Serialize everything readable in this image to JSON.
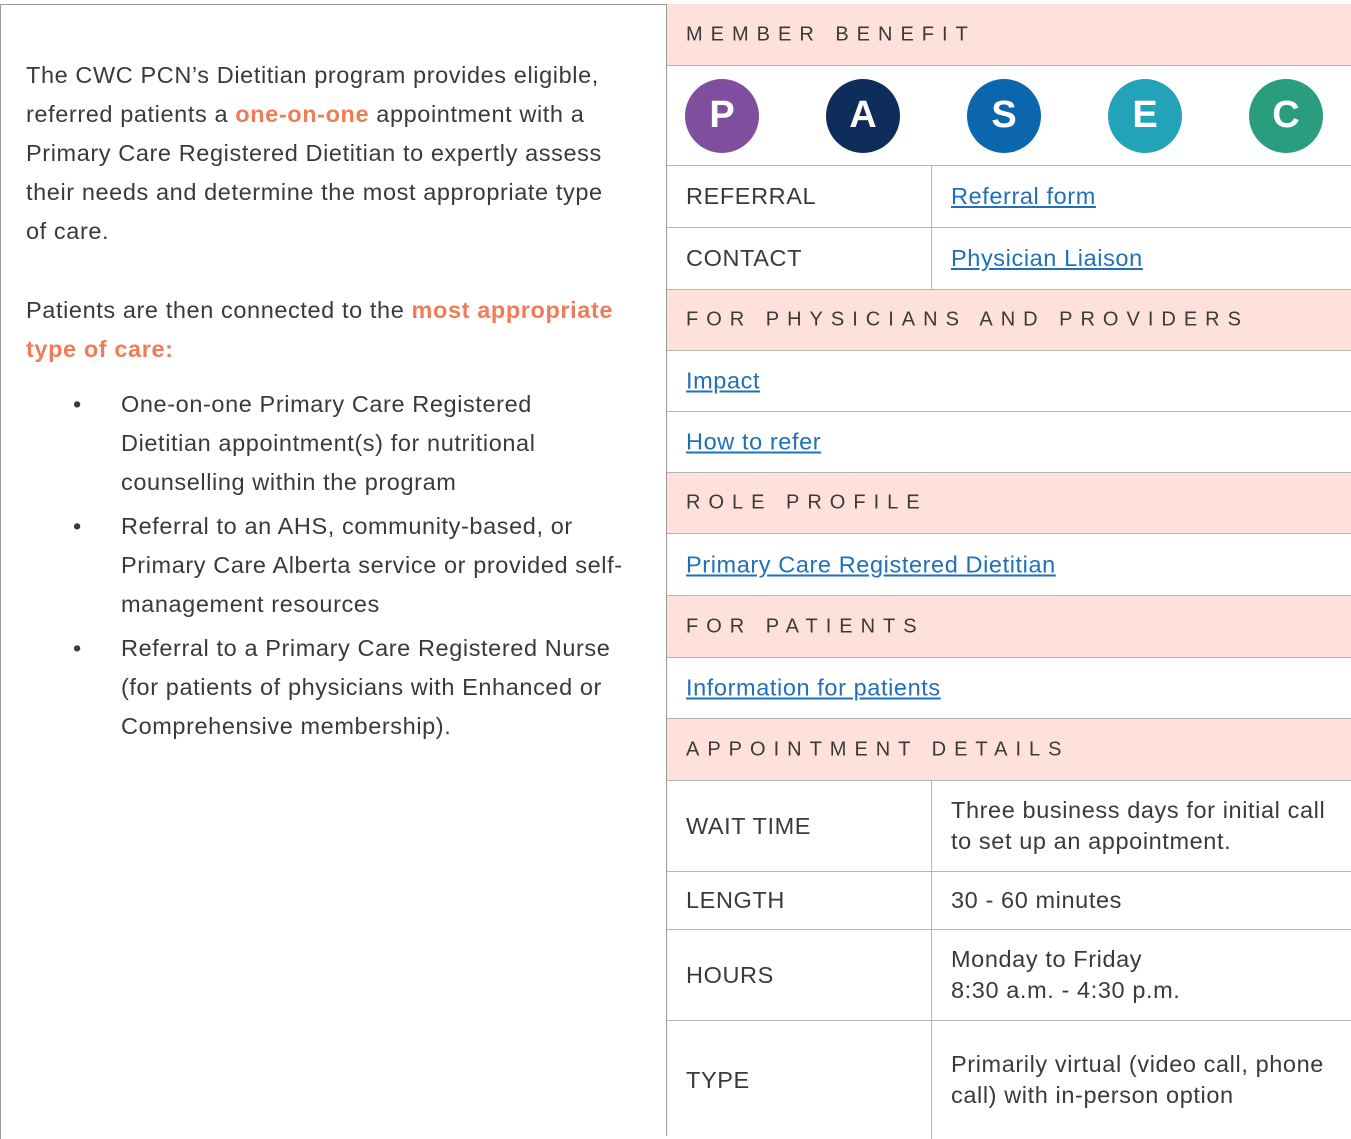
{
  "intro": {
    "p1_a": "The CWC PCN’s Dietitian program provides eligible, referred patients a ",
    "p1_hl": "one-on-one",
    "p1_b": " appointment with a Primary Care Registered Dietitian to expertly assess their needs and determine the most appropriate type of care.",
    "p2_a": "Patients are then connected to the ",
    "p2_hl": "most appropriate type of care:",
    "bullet": "•",
    "items": [
      "One-on-one Primary Care Registered Dietitian appointment(s) for nutritional counselling within the program",
      "Referral to an AHS, community-based, or Primary Care Alberta service or provided self-management resources",
      "Referral to a Primary Care Registered Nurse (for patients of physicians with Enhanced or Comprehensive membership)."
    ]
  },
  "sidebar": {
    "member_benefit": "MEMBER BENEFIT",
    "circles": [
      {
        "letter": "P",
        "color": "#7f4f9e"
      },
      {
        "letter": "A",
        "color": "#0f2d5b"
      },
      {
        "letter": "S",
        "color": "#0b66ad"
      },
      {
        "letter": "E",
        "color": "#22a3b8"
      },
      {
        "letter": "C",
        "color": "#2a9d7e"
      }
    ],
    "referral_label": "REFERRAL",
    "referral_link": "Referral form",
    "contact_label": "CONTACT",
    "contact_link": "Physician Liaison",
    "physicians_header": "FOR PHYSICIANS AND PROVIDERS",
    "impact_link": "Impact",
    "how_to_refer_link": "How to refer",
    "role_profile_header": "ROLE PROFILE",
    "role_profile_link": "Primary Care Registered Dietitian",
    "patients_header": "FOR PATIENTS",
    "patients_link": "Information for patients",
    "appointment_header": "APPOINTMENT DETAILS",
    "details": [
      {
        "label": "WAIT TIME",
        "value": "Three business days for initial call to set up an appointment."
      },
      {
        "label": "LENGTH",
        "value": "30 - 60 minutes"
      },
      {
        "label": "HOURS",
        "value": "Monday to Friday\n8:30 a.m. - 4:30 p.m."
      },
      {
        "label": "TYPE",
        "value": "Primarily virtual (video call, phone call) with in-person option"
      }
    ]
  }
}
